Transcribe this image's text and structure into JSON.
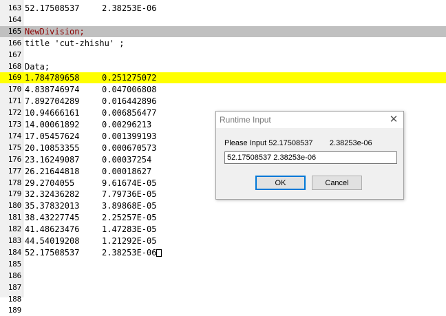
{
  "editor": {
    "lines": [
      {
        "n": "163",
        "c1": "52.17508537",
        "c2": "2.38253E-06",
        "hl": ""
      },
      {
        "n": "164",
        "c1": "",
        "c2": "",
        "hl": ""
      },
      {
        "n": "165",
        "c1": "NewDivision;",
        "c2": "",
        "hl": "gray",
        "kw": true
      },
      {
        "n": "166",
        "c1": "title 'cut-zhishu' ;",
        "c2": "",
        "hl": ""
      },
      {
        "n": "167",
        "c1": "",
        "c2": "",
        "hl": ""
      },
      {
        "n": "168",
        "c1": "Data;",
        "c2": "",
        "hl": ""
      },
      {
        "n": "169",
        "c1": "1.784789658",
        "c2": "0.251275072",
        "hl": "yellow"
      },
      {
        "n": "170",
        "c1": "4.838746974",
        "c2": "0.047006808",
        "hl": ""
      },
      {
        "n": "171",
        "c1": "7.892704289",
        "c2": "0.016442896",
        "hl": ""
      },
      {
        "n": "172",
        "c1": "10.94666161",
        "c2": "0.006856477",
        "hl": ""
      },
      {
        "n": "173",
        "c1": "14.00061892",
        "c2": "0.00296213",
        "hl": ""
      },
      {
        "n": "174",
        "c1": "17.05457624",
        "c2": "0.001399193",
        "hl": ""
      },
      {
        "n": "175",
        "c1": "20.10853355",
        "c2": "0.000670573",
        "hl": ""
      },
      {
        "n": "176",
        "c1": "23.16249087",
        "c2": "0.00037254",
        "hl": ""
      },
      {
        "n": "177",
        "c1": "26.21644818",
        "c2": "0.00018627",
        "hl": ""
      },
      {
        "n": "178",
        "c1": "29.2704055",
        "c2": "9.61674E-05",
        "hl": ""
      },
      {
        "n": "179",
        "c1": "32.32436282",
        "c2": "7.79736E-05",
        "hl": ""
      },
      {
        "n": "180",
        "c1": "35.37832013",
        "c2": "3.89868E-05",
        "hl": ""
      },
      {
        "n": "181",
        "c1": "38.43227745",
        "c2": "2.25257E-05",
        "hl": ""
      },
      {
        "n": "182",
        "c1": "41.48623476",
        "c2": "1.47283E-05",
        "hl": ""
      },
      {
        "n": "183",
        "c1": "44.54019208",
        "c2": "1.21292E-05",
        "hl": ""
      },
      {
        "n": "184",
        "c1": "52.17508537",
        "c2": "2.38253E-06",
        "hl": "",
        "box": true
      },
      {
        "n": "185",
        "c1": "",
        "c2": "",
        "hl": ""
      },
      {
        "n": "186",
        "c1": "",
        "c2": "",
        "hl": ""
      },
      {
        "n": "187",
        "c1": "",
        "c2": "",
        "hl": ""
      },
      {
        "n": "188",
        "c1": "",
        "c2": "",
        "hl": ""
      },
      {
        "n": "189",
        "c1": "",
        "c2": "",
        "hl": ""
      }
    ]
  },
  "dialog": {
    "title": "Runtime Input",
    "close_glyph": "✕",
    "prompt": "Please Input 52.17508537        2.38253e-06",
    "input_value": "52.17508537 2.38253e-06",
    "ok_label": "OK",
    "cancel_label": "Cancel"
  }
}
